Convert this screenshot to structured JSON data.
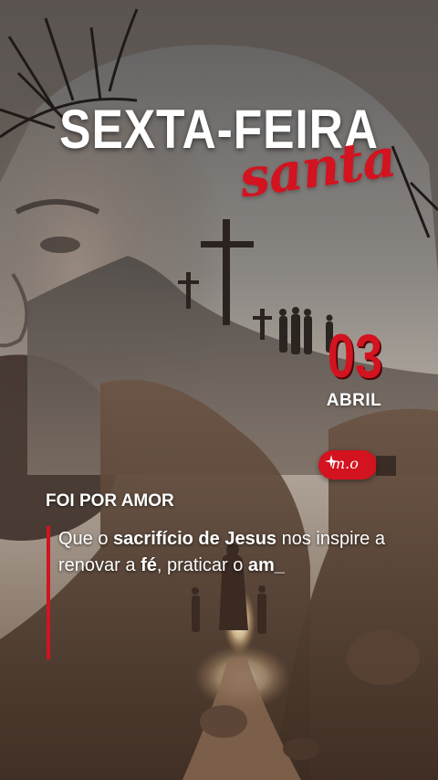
{
  "title": {
    "main": "SEXTA-FEIRA",
    "script": "santa"
  },
  "date": {
    "day": "03",
    "month": "ABRIL"
  },
  "logo": {
    "text": "m.o"
  },
  "subtitle": "FOI POR AMOR",
  "message": {
    "part1": "Que o ",
    "bold1": "sacrifício de Jesus",
    "part2": " nos inspire a renovar a ",
    "bold2": "fé",
    "part3": ", praticar o ",
    "bold3": "am_"
  },
  "colors": {
    "accent": "#d3131f",
    "text": "#ffffff"
  },
  "icons": [
    "crown-of-thorns-icon",
    "cross-icon",
    "sparkle-icon"
  ]
}
